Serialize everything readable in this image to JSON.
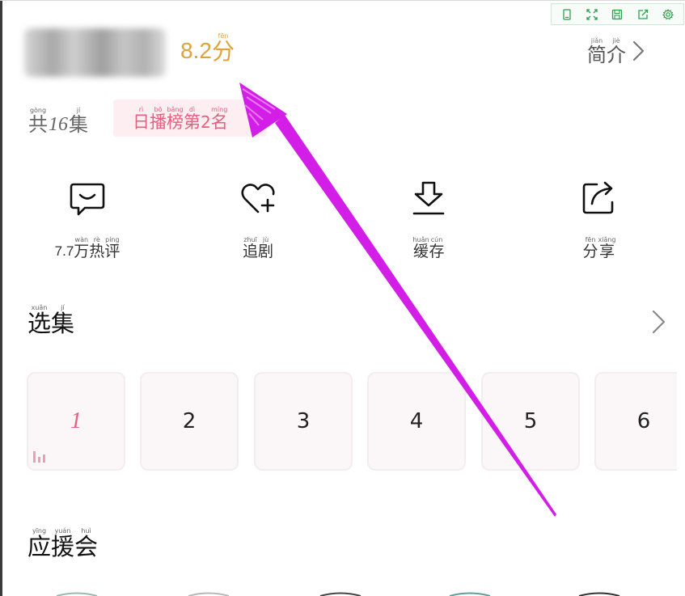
{
  "header": {
    "score_value": "8.2",
    "score_unit": {
      "char": "分",
      "pinyin": "fēn"
    },
    "intro_label": [
      {
        "char": "简",
        "pinyin": "jiǎn"
      },
      {
        "char": "介",
        "pinyin": "jiè"
      }
    ]
  },
  "episodes_count": {
    "prefix": {
      "char": "共",
      "pinyin": "gòng"
    },
    "number": "16",
    "suffix": {
      "char": "集",
      "pinyin": "jí"
    }
  },
  "rank_badge": {
    "chars": [
      {
        "char": "日",
        "pinyin": "rì"
      },
      {
        "char": "播",
        "pinyin": "bō"
      },
      {
        "char": "榜",
        "pinyin": "bǎng"
      },
      {
        "char": "第",
        "pinyin": "dì"
      }
    ],
    "number": "2",
    "suffix": {
      "char": "名",
      "pinyin": "míng"
    }
  },
  "actions": [
    {
      "name": "comments",
      "prefix": "7.7",
      "chars": [
        {
          "char": "万",
          "pinyin": "wàn"
        },
        {
          "char": "热",
          "pinyin": "rè"
        },
        {
          "char": "评",
          "pinyin": "píng"
        }
      ],
      "icon": "comment-bubble-icon"
    },
    {
      "name": "follow",
      "prefix": "",
      "chars": [
        {
          "char": "追",
          "pinyin": "zhuī"
        },
        {
          "char": "剧",
          "pinyin": "jù"
        }
      ],
      "icon": "heart-plus-icon"
    },
    {
      "name": "cache",
      "prefix": "",
      "chars": [
        {
          "char": "缓",
          "pinyin": "huǎn"
        },
        {
          "char": "存",
          "pinyin": "cún"
        }
      ],
      "icon": "download-icon"
    },
    {
      "name": "share",
      "prefix": "",
      "chars": [
        {
          "char": "分",
          "pinyin": "fēn"
        },
        {
          "char": "享",
          "pinyin": "xiǎng"
        }
      ],
      "icon": "share-icon"
    }
  ],
  "select_section": {
    "title": [
      {
        "char": "选",
        "pinyin": "xuǎn"
      },
      {
        "char": "集",
        "pinyin": "jí"
      }
    ]
  },
  "episodes": [
    "1",
    "2",
    "3",
    "4",
    "5",
    "6"
  ],
  "active_episode": "1",
  "support_section": {
    "title": [
      {
        "char": "应",
        "pinyin": "yīng"
      },
      {
        "char": "援",
        "pinyin": "yuán"
      },
      {
        "char": "会",
        "pinyin": "huì"
      }
    ]
  },
  "colors": {
    "score": "#e0a23a",
    "accent_pink": "#e4607f",
    "badge_bg": "#fdeef2",
    "arrow": "#d21ee6",
    "toolbar_icon": "#2e9e4f"
  },
  "toolbar_icons": [
    "phone-icon",
    "fullscreen-icon",
    "save-icon",
    "share-out-icon",
    "settings-icon"
  ]
}
